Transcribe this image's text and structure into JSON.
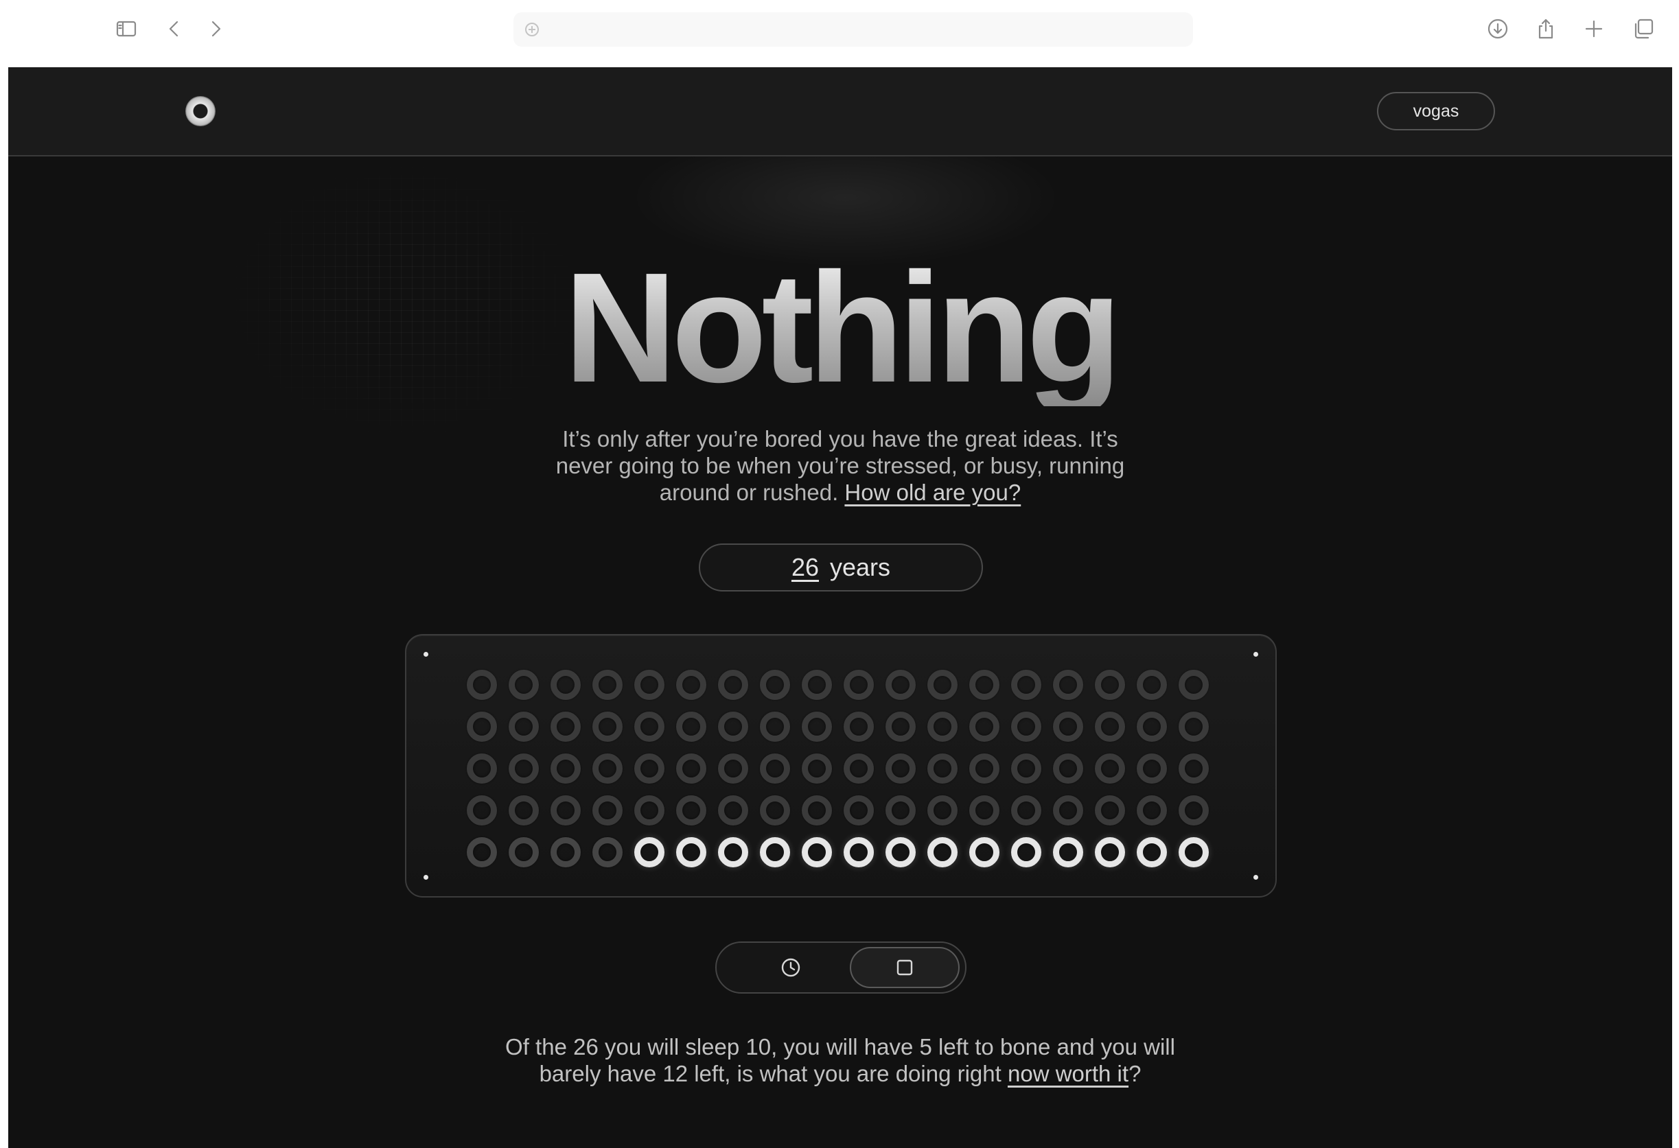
{
  "browser": {
    "icons": [
      "sidebar-icon",
      "back-icon",
      "forward-icon",
      "downloads-icon",
      "share-icon",
      "new-tab-icon",
      "tabs-overview-icon"
    ],
    "address_icon": "plus-circle-icon"
  },
  "nav": {
    "logo": "ring-logo-icon",
    "user_label": "vogas"
  },
  "hero": {
    "title": "Nothing",
    "intro_text": "It’s only after you’re bored you have the great ideas. It’s never going to be when you’re stressed, or busy, running around or rushed. ",
    "intro_link": "How old are you?"
  },
  "age": {
    "value": "26",
    "unit": "years"
  },
  "grid": {
    "columns": 18,
    "rows": 5,
    "filled_count": 14,
    "colors": {
      "dim": "#3a3a3a",
      "lit": "#e6e6e6"
    }
  },
  "view_toggle": {
    "options": [
      {
        "icon": "clock-icon",
        "active": false
      },
      {
        "icon": "square-icon",
        "active": true
      }
    ]
  },
  "outro": {
    "text": "Of the 26 you will sleep 10, you will have 5 left to bone and you will barely have 12 left, is what you are doing right ",
    "link": "now worth it",
    "end": "?"
  },
  "colors": {
    "page_bg": "#111111",
    "nav_bg": "#1b1b1b",
    "text": "#b5b5b5"
  }
}
